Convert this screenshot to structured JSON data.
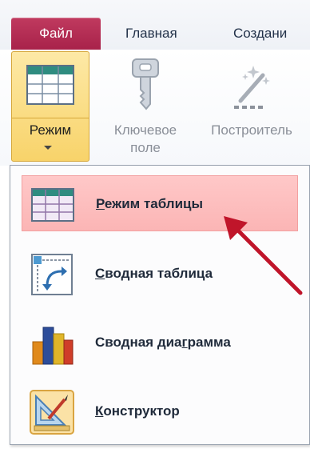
{
  "tabs": {
    "file": "Файл",
    "home": "Главная",
    "create": "Создани"
  },
  "ribbon": {
    "mode_button": {
      "label": "Режим"
    },
    "key_field": {
      "line1": "Ключевое",
      "line2": "поле"
    },
    "builder": {
      "label": "Построитель"
    }
  },
  "dropdown": {
    "items": [
      {
        "key": "Р",
        "rest": "ежим таблицы",
        "icon": "datasheet-view-icon",
        "selected": true
      },
      {
        "key": "С",
        "rest": "водная таблица",
        "icon": "pivot-table-icon",
        "selected": false
      },
      {
        "pre": "Сводная диа",
        "key": "г",
        "rest": "рамма",
        "icon": "pivot-chart-icon",
        "selected": false
      },
      {
        "key": "К",
        "rest": "онструктор",
        "icon": "design-view-icon",
        "selected": false
      }
    ]
  },
  "colors": {
    "file_tab": "#b12c52",
    "selected_item": "#fbb8b8",
    "annotation_arrow": "#c0152a"
  }
}
